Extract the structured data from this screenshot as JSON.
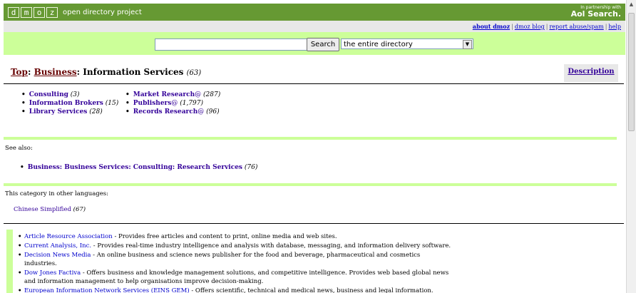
{
  "header": {
    "logo_letters": [
      "d",
      "m",
      "o",
      "z"
    ],
    "tagline": "open directory project",
    "partner_small": "In partnership with",
    "partner_brand": "Aol Search."
  },
  "util_links": {
    "about": "about dmoz",
    "blog": "dmoz blog",
    "report": "report abuse/spam",
    "help": "help"
  },
  "search": {
    "query": "",
    "button_label": "Search",
    "scope": "the entire directory"
  },
  "breadcrumb": {
    "top": "Top",
    "sep1": ": ",
    "business": "Business",
    "sep2": ": ",
    "current": "Information Services",
    "count": "(63)"
  },
  "description_tab": "Description",
  "subcategories": {
    "col1": [
      {
        "name": "Consulting",
        "count": "(3)"
      },
      {
        "name": "Information Brokers",
        "count": "(15)"
      },
      {
        "name": "Library Services",
        "count": "(28)"
      }
    ],
    "col2": [
      {
        "name": "Market Research",
        "at": "@",
        "count": "(287)"
      },
      {
        "name": "Publishers",
        "at": "@",
        "count": "(1,797)"
      },
      {
        "name": "Records Research",
        "at": "@",
        "count": "(96)"
      }
    ]
  },
  "see_also": {
    "label": "See also:",
    "item": "Business: Business Services: Consulting: Research Services",
    "count": "(76)"
  },
  "other_languages": {
    "label": "This category in other languages:",
    "item": "Chinese Simplified",
    "count": "(67)"
  },
  "sites": [
    {
      "title": "Article Resource Association",
      "desc": " - Provides free articles and content to print, online media and web sites."
    },
    {
      "title": "Current Analysis, Inc.",
      "desc": " - Provides real-time industry intelligence and analysis with database, messaging, and information delivery software."
    },
    {
      "title": "Decision News Media",
      "desc": " - An online business and science news publisher for the food and beverage, pharmaceutical and cosmetics industries."
    },
    {
      "title": "Dow Jones Factiva",
      "desc": " - Offers business and knowledge management solutions, and competitive intelligence. Provides web based global news and information management to help organisations improve decision-making."
    },
    {
      "title": "European Information Network Services (EINS GEM)",
      "desc": " - Offers scientific, technical and medical news, business and legal information."
    }
  ]
}
